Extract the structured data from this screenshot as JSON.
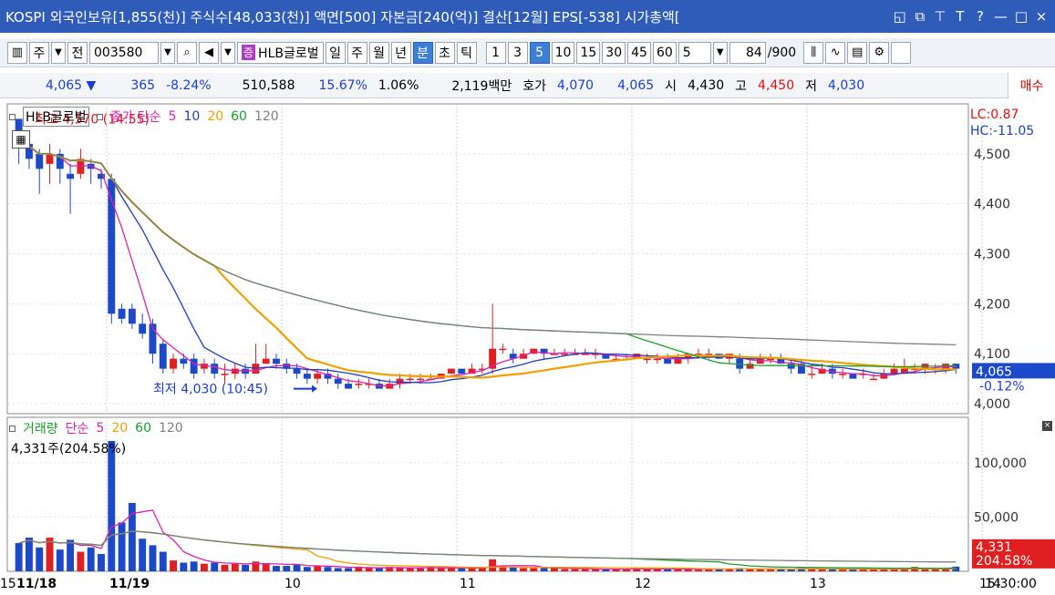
{
  "title": "KOSPI 외국인보유[1,855(천)] 주식수[48,033(천)] 액면[500] 자본금[240(억)] 결산[12월] EPS[-538] 시가총액[",
  "titlebar_icons": [
    "restore-icon",
    "copy-icon",
    "pin-icon",
    "font-icon",
    "help-icon",
    "minimize-icon",
    "maximize-icon",
    "close-icon"
  ],
  "toolbar": {
    "mode_label": "주",
    "region_label": "전",
    "code": "003580",
    "stock_name": "HLB글로벌",
    "jeung_label": "증",
    "periods": [
      "일",
      "주",
      "월",
      "년",
      "분",
      "초",
      "틱"
    ],
    "selected_period": "분",
    "intervals": [
      "1",
      "3",
      "5",
      "10",
      "15",
      "30",
      "45",
      "60"
    ],
    "selected_interval": "5",
    "interval_select": "5",
    "count": "84",
    "count_total": "/900"
  },
  "quote": {
    "price": "4,065",
    "arrow": "▼",
    "change": "365",
    "change_pct": "-8.24%",
    "volume": "510,588",
    "turnover_pct": "15.67%",
    "other_pct": "1.06%",
    "amount": "2,119백만",
    "hoga_label": "호가",
    "ask": "4,070",
    "bid": "4,065",
    "open_label": "시",
    "open": "4,430",
    "high_label": "고",
    "high": "4,450",
    "low_label": "저",
    "low": "4,030",
    "buy_label": "매수"
  },
  "price_legend": {
    "name": "HLB글로벌",
    "series_label": "종가 단순",
    "ma": [
      "5",
      "10",
      "20",
      "60",
      "120"
    ]
  },
  "volume_legend": {
    "name": "거래량",
    "series_label": "단순",
    "ma": [
      "5",
      "20",
      "60",
      "120"
    ],
    "current": "4,331주(204.58%)"
  },
  "annotations": {
    "high": "최고 4,570 (14:55)",
    "low": "최저 4,030 (10:45)"
  },
  "right_labels": {
    "lc": "LC:0.87",
    "hc": "HC:-11.05",
    "current_price": "4,065",
    "current_pct": "-0.12%",
    "current_volume": "4,331",
    "current_vol_pct": "204.58%"
  },
  "time_labels": [
    "11/18",
    "11/19",
    "10",
    "11",
    "12",
    "13",
    "14",
    "15"
  ],
  "clock": "15:30:00",
  "colors": {
    "up": "#e02020",
    "down": "#1b49c9",
    "ma5": "#e020b0",
    "ma10": "#1f3fbf",
    "ma20": "#f0a000",
    "ma60": "#1aa02a",
    "ma120": "#808080",
    "titlebar": "#2e5cb8",
    "selected": "#3d7fd6"
  },
  "chart_data": {
    "type": "candlestick",
    "y_axis_ticks": [
      4000,
      4100,
      4200,
      4300,
      4400,
      4500
    ],
    "ylim": [
      3980,
      4600
    ],
    "volume_ticks": [
      50000,
      100000
    ],
    "volume_ylim": [
      0,
      125000
    ],
    "candles": [
      [
        4570,
        4540,
        4570,
        4480
      ],
      [
        4520,
        4490,
        4530,
        4470
      ],
      [
        4500,
        4470,
        4510,
        4420
      ],
      [
        4480,
        4500,
        4520,
        4440
      ],
      [
        4500,
        4470,
        4510,
        4440
      ],
      [
        4460,
        4450,
        4480,
        4380
      ],
      [
        4460,
        4490,
        4510,
        4450
      ],
      [
        4480,
        4470,
        4490,
        4440
      ],
      [
        4460,
        4450,
        4470,
        4430
      ],
      [
        4450,
        4180,
        4460,
        4160
      ],
      [
        4190,
        4170,
        4200,
        4160
      ],
      [
        4190,
        4160,
        4200,
        4150
      ],
      [
        4160,
        4140,
        4180,
        4130
      ],
      [
        4160,
        4100,
        4170,
        4080
      ],
      [
        4120,
        4070,
        4130,
        4060
      ],
      [
        4070,
        4090,
        4100,
        4060
      ],
      [
        4090,
        4080,
        4100,
        4070
      ],
      [
        4090,
        4060,
        4100,
        4050
      ],
      [
        4070,
        4080,
        4090,
        4060
      ],
      [
        4080,
        4060,
        4090,
        4050
      ],
      [
        4060,
        4060,
        4080,
        4040
      ],
      [
        4060,
        4070,
        4080,
        4050
      ],
      [
        4070,
        4060,
        4080,
        4050
      ],
      [
        4060,
        4080,
        4120,
        4070
      ],
      [
        4080,
        4090,
        4120,
        4080
      ],
      [
        4090,
        4080,
        4100,
        4070
      ],
      [
        4080,
        4070,
        4090,
        4060
      ],
      [
        4070,
        4060,
        4080,
        4050
      ],
      [
        4060,
        4050,
        4070,
        4040
      ],
      [
        4050,
        4060,
        4070,
        4040
      ],
      [
        4060,
        4050,
        4070,
        4040
      ],
      [
        4050,
        4040,
        4060,
        4030
      ],
      [
        4040,
        4030,
        4050,
        4030
      ],
      [
        4040,
        4040,
        4050,
        4030
      ],
      [
        4040,
        4040,
        4050,
        4030
      ],
      [
        4040,
        4030,
        4050,
        4030
      ],
      [
        4030,
        4040,
        4050,
        4030
      ],
      [
        4040,
        4050,
        4060,
        4030
      ],
      [
        4050,
        4050,
        4060,
        4040
      ],
      [
        4050,
        4050,
        4060,
        4040
      ],
      [
        4050,
        4050,
        4060,
        4050
      ],
      [
        4050,
        4060,
        4060,
        4050
      ],
      [
        4060,
        4070,
        4070,
        4060
      ],
      [
        4070,
        4060,
        4070,
        4060
      ],
      [
        4060,
        4070,
        4080,
        4060
      ],
      [
        4070,
        4070,
        4080,
        4060
      ],
      [
        4070,
        4110,
        4200,
        4060
      ],
      [
        4110,
        4110,
        4120,
        4100
      ],
      [
        4100,
        4090,
        4110,
        4080
      ],
      [
        4090,
        4100,
        4110,
        4090
      ],
      [
        4100,
        4110,
        4110,
        4100
      ],
      [
        4110,
        4100,
        4110,
        4090
      ],
      [
        4100,
        4100,
        4110,
        4100
      ],
      [
        4100,
        4100,
        4110,
        4100
      ],
      [
        4100,
        4100,
        4110,
        4100
      ],
      [
        4100,
        4100,
        4110,
        4100
      ],
      [
        4100,
        4100,
        4110,
        4090
      ],
      [
        4100,
        4090,
        4100,
        4090
      ],
      [
        4090,
        4090,
        4100,
        4090
      ],
      [
        4090,
        4090,
        4100,
        4090
      ],
      [
        4090,
        4100,
        4100,
        4090
      ],
      [
        4090,
        4090,
        4100,
        4080
      ],
      [
        4090,
        4090,
        4100,
        4080
      ],
      [
        4090,
        4080,
        4100,
        4080
      ],
      [
        4080,
        4090,
        4100,
        4080
      ],
      [
        4090,
        4100,
        4100,
        4080
      ],
      [
        4100,
        4100,
        4110,
        4090
      ],
      [
        4100,
        4100,
        4110,
        4090
      ],
      [
        4100,
        4090,
        4100,
        4090
      ],
      [
        4090,
        4100,
        4100,
        4080
      ],
      [
        4090,
        4070,
        4100,
        4060
      ],
      [
        4070,
        4080,
        4090,
        4070
      ],
      [
        4080,
        4090,
        4100,
        4080
      ],
      [
        4090,
        4090,
        4100,
        4080
      ],
      [
        4090,
        4080,
        4100,
        4080
      ],
      [
        4080,
        4070,
        4090,
        4060
      ],
      [
        4080,
        4060,
        4090,
        4060
      ],
      [
        4060,
        4060,
        4080,
        4050
      ],
      [
        4060,
        4070,
        4080,
        4060
      ],
      [
        4070,
        4060,
        4080,
        4050
      ],
      [
        4060,
        4060,
        4070,
        4050
      ],
      [
        4060,
        4050,
        4060,
        4050
      ],
      [
        4060,
        4060,
        4070,
        4050
      ],
      [
        4050,
        4050,
        4060,
        4050
      ],
      [
        4050,
        4060,
        4070,
        4050
      ],
      [
        4060,
        4070,
        4080,
        4060
      ],
      [
        4060,
        4070,
        4090,
        4060
      ],
      [
        4070,
        4070,
        4080,
        4060
      ],
      [
        4070,
        4080,
        4080,
        4060
      ],
      [
        4070,
        4070,
        4080,
        4060
      ],
      [
        4070,
        4080,
        4080,
        4060
      ],
      [
        4080,
        4070,
        4080,
        4060
      ]
    ],
    "volume": [
      26000,
      31000,
      22000,
      31000,
      20000,
      29000,
      18000,
      22000,
      16000,
      120000,
      45000,
      63000,
      30000,
      24000,
      18000,
      10000,
      8000,
      9000,
      7000,
      8000,
      6000,
      7000,
      6000,
      9000,
      7000,
      5000,
      5000,
      6000,
      4000,
      5000,
      4000,
      3000,
      3000,
      4000,
      3000,
      3000,
      4000,
      3000,
      3000,
      3000,
      4000,
      3000,
      3000,
      3000,
      3000,
      3000,
      11000,
      5000,
      4000,
      3000,
      3000,
      3000,
      3000,
      2000,
      2000,
      2000,
      2000,
      2000,
      2000,
      2000,
      3000,
      2000,
      2000,
      2000,
      2000,
      2000,
      2000,
      2000,
      2000,
      2000,
      3000,
      2000,
      2000,
      2000,
      2000,
      2000,
      3000,
      2000,
      2000,
      2000,
      2000,
      2000,
      2000,
      2000,
      2000,
      2000,
      2000,
      4000,
      2000,
      3000,
      3000,
      4331
    ]
  }
}
